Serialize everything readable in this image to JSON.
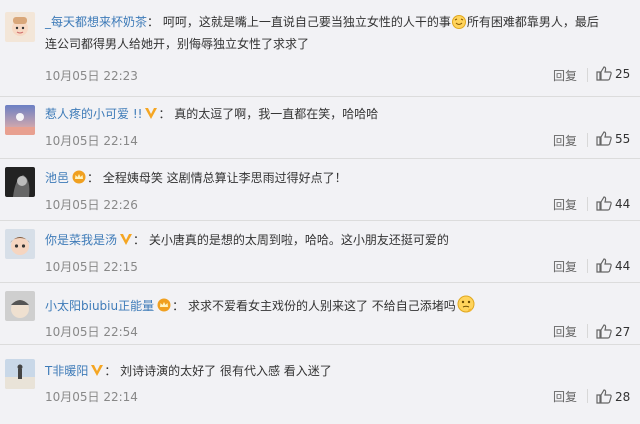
{
  "comments": [
    {
      "username": "_每天都想来杯奶茶",
      "badge": "none",
      "text_part1": "呵呵，这就是嘴上一直说自己要当独立女性的人干的事",
      "emoji1": "smile-face-emoji",
      "text_part2": "所有困难都靠男人，最后",
      "text_line2": "连公司都得男人给她开，别侮辱独立女性了求求了",
      "time": "10月05日 22:23",
      "reply_label": "回复",
      "likes": "25"
    },
    {
      "username": "惹人疼的小可爱 !!",
      "badge": "verified-v",
      "text_part1": "真的太逗了啊，我一直都在笑，哈哈哈",
      "time": "10月05日 22:14",
      "reply_label": "回复",
      "likes": "55"
    },
    {
      "username": "池邑",
      "badge": "crown",
      "text_part1": "全程姨母笑 这剧情总算让李思雨过得好点了！",
      "time": "10月05日 22:26",
      "reply_label": "回复",
      "likes": "44"
    },
    {
      "username": "你是菜我是汤",
      "badge": "verified-v",
      "text_part1": "关小唐真的是想的太周到啦，哈哈。这小朋友还挺可爱的",
      "time": "10月05日 22:15",
      "reply_label": "回复",
      "likes": "44"
    },
    {
      "username": "小太阳biubiu正能量",
      "badge": "crown",
      "text_part1": "求求不爱看女主戏份的人别来这了 不给自己添堵吗",
      "emoji1": "thinking-face-emoji",
      "time": "10月05日 22:54",
      "reply_label": "回复",
      "likes": "27"
    },
    {
      "username": "T非暖阳",
      "badge": "verified-v",
      "text_part1": "刘诗诗演的太好了 很有代入感 看入迷了",
      "time": "10月05日 22:14",
      "reply_label": "回复",
      "likes": "28"
    }
  ],
  "colors": {
    "username": "#3e7bb8",
    "background": "#f2f2f5",
    "badge_v": "#f5a623",
    "crown": "#f0a020"
  }
}
